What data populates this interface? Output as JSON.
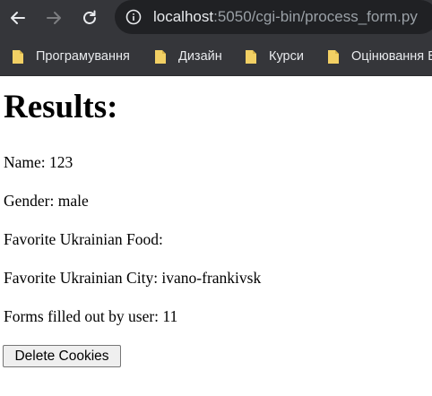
{
  "browser": {
    "url_host": "localhost",
    "url_path": ":5050/cgi-bin/process_form.py",
    "icons": [
      "back-arrow-icon",
      "forward-arrow-icon",
      "reload-icon",
      "site-info-icon",
      "folder-icon"
    ]
  },
  "bookmarks": [
    {
      "label": "Програмування"
    },
    {
      "label": "Дизайн"
    },
    {
      "label": "Курси"
    },
    {
      "label": "Оцінювання Б"
    }
  ],
  "page": {
    "heading": "Results:",
    "name_line": "Name: 123",
    "gender_line": "Gender: male",
    "food_line": "Favorite Ukrainian Food:",
    "city_line": "Favorite Ukrainian City: ivano-frankivsk",
    "count_line": "Forms filled out by user: 11",
    "delete_button_label": "Delete Cookies"
  },
  "colors": {
    "chrome_bg": "#35363a",
    "omnibox_bg": "#202124",
    "folder_yellow": "#f2d064"
  }
}
